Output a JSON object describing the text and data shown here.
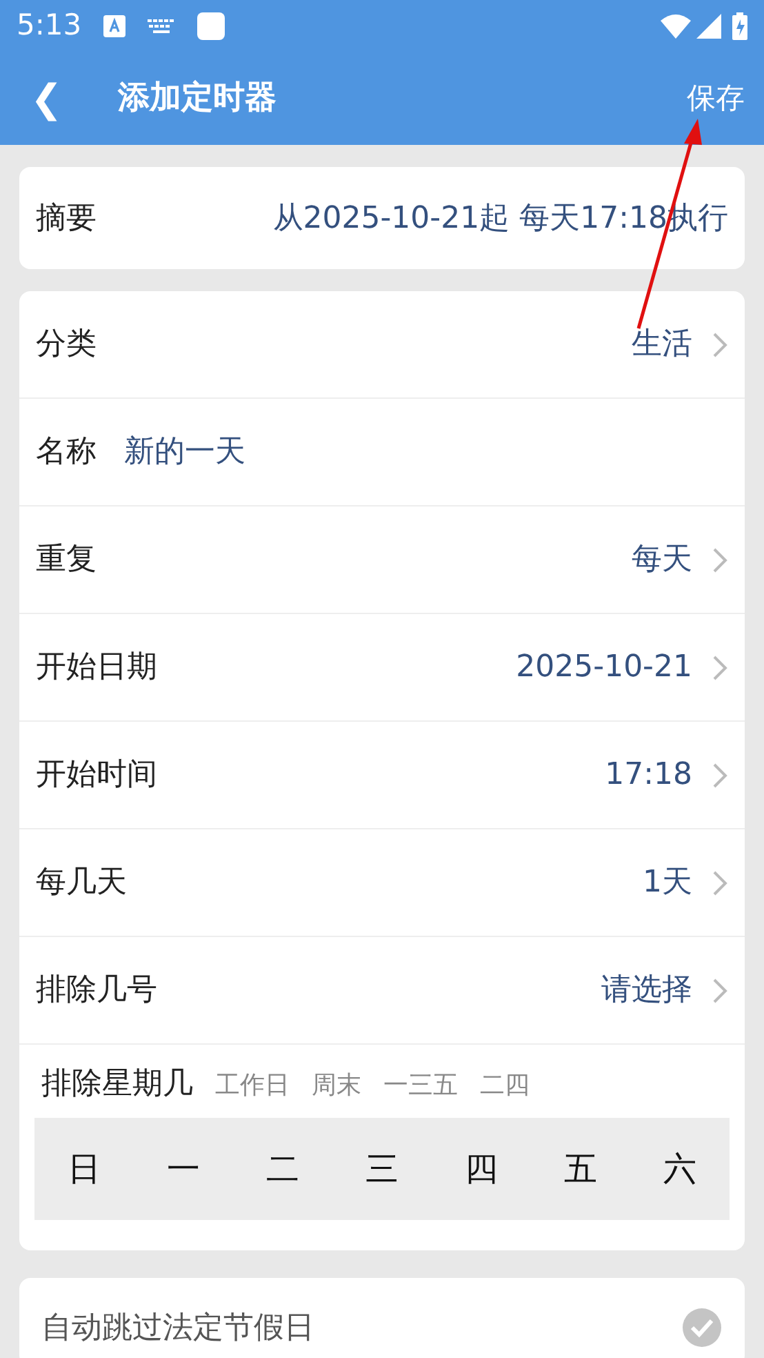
{
  "status_bar": {
    "time": "5:13"
  },
  "app_bar": {
    "back": "❮",
    "title": "添加定时器",
    "action": "保存"
  },
  "summary": {
    "label": "摘要",
    "value": "从2025-10-21起 每天17:18执行"
  },
  "fields": [
    {
      "kind": "select",
      "label": "分类",
      "value": "生活"
    },
    {
      "kind": "input",
      "label": "名称",
      "value": "新的一天"
    },
    {
      "kind": "select",
      "label": "重复",
      "value": "每天"
    },
    {
      "kind": "select",
      "label": "开始日期",
      "value": "2025-10-21"
    },
    {
      "kind": "select",
      "label": "开始时间",
      "value": "17:18"
    },
    {
      "kind": "select",
      "label": "每几天",
      "value": "1天"
    },
    {
      "kind": "select",
      "label": "排除几号",
      "value": "请选择"
    }
  ],
  "exclude_weekdays": {
    "label": "排除星期几",
    "presets": [
      "工作日",
      "周末",
      "一三五",
      "二四"
    ],
    "days": [
      {
        "label": "日",
        "selected": false
      },
      {
        "label": "一",
        "selected": false
      },
      {
        "label": "二",
        "selected": false
      },
      {
        "label": "三",
        "selected": false
      },
      {
        "label": "四",
        "selected": false
      },
      {
        "label": "五",
        "selected": false
      },
      {
        "label": "六",
        "selected": false
      }
    ]
  },
  "skip_holidays": {
    "label": "自动跳过法定节假日",
    "checked": false
  }
}
